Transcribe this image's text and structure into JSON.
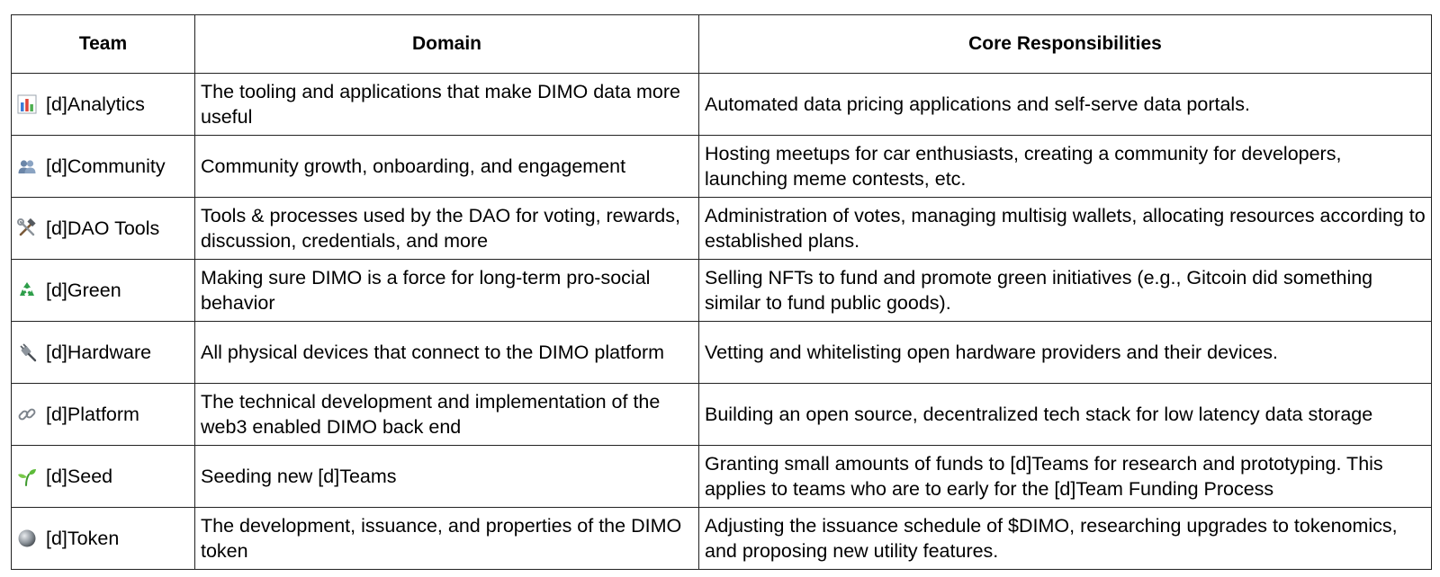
{
  "table": {
    "headers": [
      "Team",
      "Domain",
      "Core Responsibilities"
    ],
    "rows": [
      {
        "icon": "bar-chart-icon",
        "team": "[d]Analytics",
        "domain": "The tooling and applications that make DIMO data more useful",
        "core": "Automated data pricing applications and self-serve data portals."
      },
      {
        "icon": "people-icon",
        "team": "[d]Community",
        "domain": "Community growth, onboarding, and engagement",
        "core": "Hosting meetups for car enthusiasts, creating a community for developers, launching meme contests, etc."
      },
      {
        "icon": "hammer-wrench-icon",
        "team": "[d]DAO Tools",
        "domain": "Tools & processes used by the DAO for voting, rewards, discussion, credentials, and more",
        "core": "Administration of votes, managing multisig wallets, allocating resources according to established plans."
      },
      {
        "icon": "recycle-icon",
        "team": "[d]Green",
        "domain": "Making sure DIMO is a force for long-term pro-social behavior",
        "core": "Selling NFTs to fund and promote green initiatives (e.g., Gitcoin did something similar to fund public goods)."
      },
      {
        "icon": "plug-icon",
        "team": "[d]Hardware",
        "domain": "All physical devices that connect to the DIMO platform",
        "core": "Vetting  and whitelisting open hardware providers and their devices."
      },
      {
        "icon": "link-icon",
        "team": "[d]Platform",
        "domain": "The technical development and implementation of the web3 enabled DIMO back end",
        "core": "Building an open source, decentralized tech stack for low latency data storage"
      },
      {
        "icon": "seedling-icon",
        "team": "[d]Seed",
        "domain": "Seeding new [d]Teams",
        "core": "Granting small amounts of funds to [d]Teams for research and prototyping. This applies to teams who are to early for the [d]Team Funding Process"
      },
      {
        "icon": "coin-icon",
        "team": "[d]Token",
        "domain": "The development, issuance, and properties of the DIMO token",
        "core": "Adjusting the issuance schedule of $DIMO, researching upgrades to tokenomics, and proposing new utility features."
      }
    ]
  }
}
